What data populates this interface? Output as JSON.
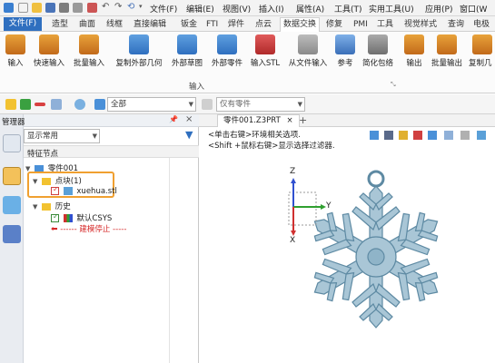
{
  "menubar": {
    "items": [
      "文件(F)",
      "编辑(E)",
      "视图(V)",
      "插入(I)",
      "属性(A)",
      "工具(T)",
      "实用工具(U)",
      "应用(P)",
      "窗口(W"
    ]
  },
  "tabs": {
    "file": "文件(F)",
    "items": [
      "造型",
      "曲面",
      "线框",
      "直接编辑",
      "钣金",
      "FTI",
      "焊件",
      "点云",
      "数据交换",
      "修复",
      "PMI",
      "工具",
      "视觉样式",
      "查询",
      "电极"
    ],
    "active": "数据交换"
  },
  "ribbon": {
    "buttons": [
      "输入",
      "快速输入",
      "批量输入",
      "复制外部几何",
      "外部草图",
      "外部零件",
      "输入STL",
      "从文件输入",
      "参考",
      "简化包络",
      "输出",
      "批量输出",
      "复制几"
    ],
    "group_label": "输入"
  },
  "toolbar": {
    "filter_value": "全部",
    "pick_value": "仅有零件"
  },
  "manager": {
    "title": "管理器",
    "display_combo": "显示常用",
    "column_header": "特征节点",
    "tree": {
      "root": "零件001",
      "group": "点块(1)",
      "file": "xuehua.stl",
      "history": "历史",
      "csys": "默认CSYS",
      "stop": "------ 建模停止 -----"
    }
  },
  "document": {
    "tab_label": "零件001.Z3PRT",
    "add_tab": "+",
    "hint1": "<单击右键>环境相关选项.",
    "hint2": "<Shift +鼠标右键>显示选择过滤器.",
    "axis_z": "Z",
    "axis_y": "Y",
    "axis_x": "X"
  },
  "colors": {
    "accent_blue": "#2f6fbf",
    "highlight_orange": "#f0a030",
    "snowflake": "#a9c6d6",
    "snowflake_edge": "#5e8aa3",
    "stop_red": "#d62828"
  }
}
